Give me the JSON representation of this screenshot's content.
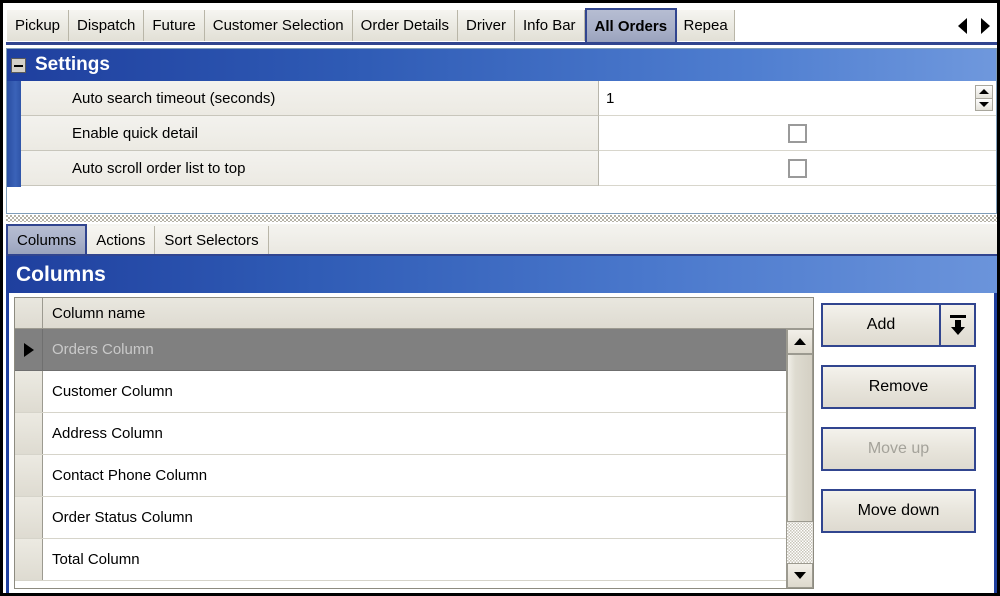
{
  "window": {
    "tabs": [
      {
        "label": "Pickup",
        "selected": false
      },
      {
        "label": "Dispatch",
        "selected": false
      },
      {
        "label": "Future",
        "selected": false
      },
      {
        "label": "Customer Selection",
        "selected": false
      },
      {
        "label": "Order Details",
        "selected": false
      },
      {
        "label": "Driver",
        "selected": false
      },
      {
        "label": "Info Bar",
        "selected": false
      },
      {
        "label": "All Orders",
        "selected": true
      },
      {
        "label": "Repea",
        "selected": false
      }
    ],
    "nav_prev_icon": "triangle-left-icon",
    "nav_next_icon": "triangle-right-icon"
  },
  "settings": {
    "title": "Settings",
    "expander_icon": "minus-box-icon",
    "rows": [
      {
        "label": "Auto search timeout (seconds)",
        "type": "spinner",
        "value": "1"
      },
      {
        "label": "Enable quick detail",
        "type": "checkbox",
        "checked": false
      },
      {
        "label": "Auto scroll order list to top",
        "type": "checkbox",
        "checked": false
      }
    ],
    "spinner_up_icon": "triangle-up-icon",
    "spinner_down_icon": "triangle-down-icon"
  },
  "lower": {
    "tabs": [
      {
        "label": "Columns",
        "selected": true
      },
      {
        "label": "Actions",
        "selected": false
      },
      {
        "label": "Sort Selectors",
        "selected": false
      }
    ],
    "header_title": "Columns",
    "grid": {
      "column_header": "Column name",
      "rows": [
        {
          "name": "Orders Column",
          "selected": true
        },
        {
          "name": "Customer Column",
          "selected": false
        },
        {
          "name": "Address Column",
          "selected": false
        },
        {
          "name": "Contact Phone Column",
          "selected": false
        },
        {
          "name": "Order Status Column",
          "selected": false
        },
        {
          "name": "Total Column",
          "selected": false
        }
      ],
      "row_pointer_icon": "triangle-right-icon",
      "scroll_up_icon": "triangle-up-icon",
      "scroll_down_icon": "triangle-down-icon"
    },
    "buttons": [
      {
        "label": "Add",
        "disabled": false,
        "split": true,
        "dropdown_icon": "insert-down-icon"
      },
      {
        "label": "Remove",
        "disabled": false,
        "split": false
      },
      {
        "label": "Move up",
        "disabled": true,
        "split": false
      },
      {
        "label": "Move down",
        "disabled": false,
        "split": false
      }
    ]
  },
  "colors": {
    "accent_blue": "#1f3f9e",
    "tab_selected": "#a9b1c9",
    "selected_row": "#808080",
    "button_border": "#31458f"
  }
}
